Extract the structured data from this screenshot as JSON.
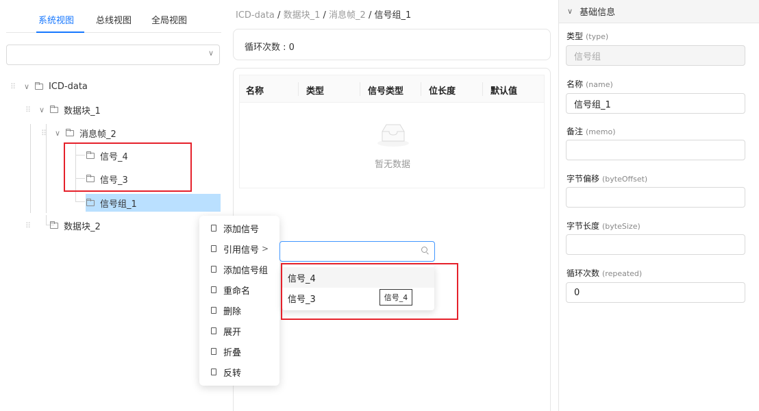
{
  "left_panel": {
    "tabs": [
      {
        "label": "系统视图",
        "active": true
      },
      {
        "label": "总线视图",
        "active": false
      },
      {
        "label": "全局视图",
        "active": false
      }
    ],
    "view_select": {
      "value": ""
    },
    "tree": {
      "root": "ICD-data",
      "block1": "数据块_1",
      "frame2": "消息帧_2",
      "signal4": "信号_4",
      "signal3": "信号_3",
      "group1": "信号组_1",
      "block2": "数据块_2"
    }
  },
  "breadcrumb": {
    "items": [
      "ICD-data",
      "数据块_1",
      "消息帧_2",
      "信号组_1"
    ],
    "separator": "/"
  },
  "loop_card": {
    "label": "循环次数 : 0"
  },
  "table": {
    "columns": [
      "名称",
      "类型",
      "信号类型",
      "位长度",
      "默认值"
    ],
    "empty_text": "暂无数据"
  },
  "context_menu": {
    "items": [
      "添加信号",
      "引用信号",
      "添加信号组",
      "重命名",
      "删除",
      "展开",
      "折叠",
      "反转"
    ],
    "submenu_arrow": ">"
  },
  "reference_search": {
    "value": "",
    "options": [
      "信号_4",
      "信号_3"
    ],
    "tooltip": "信号_4"
  },
  "properties": {
    "section_title": "基础信息",
    "fields": [
      {
        "label": "类型",
        "key": "(type)",
        "value": "信号组",
        "disabled": true
      },
      {
        "label": "名称",
        "key": "(name)",
        "value": "信号组_1",
        "disabled": false
      },
      {
        "label": "备注",
        "key": "(memo)",
        "value": "",
        "disabled": false
      },
      {
        "label": "字节偏移",
        "key": "(byteOffset)",
        "value": "",
        "disabled": false
      },
      {
        "label": "字节长度",
        "key": "(byteSize)",
        "value": "",
        "disabled": false
      },
      {
        "label": "循环次数",
        "key": "(repeated)",
        "value": "0",
        "disabled": false
      }
    ]
  },
  "colors": {
    "accent": "#1677ff",
    "selected_bg": "#bae0ff",
    "highlight_border": "#e5202a"
  }
}
